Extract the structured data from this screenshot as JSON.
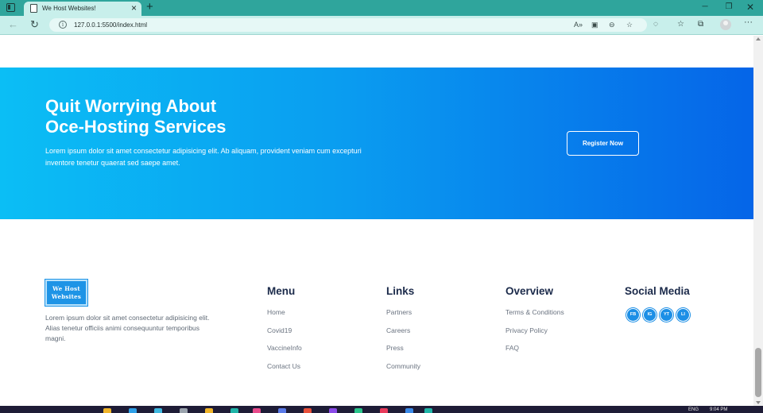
{
  "browser": {
    "tab_title": "We Host Websites!",
    "url": "127.0.0.1:5500/index.html",
    "new_tab": "+",
    "tab_close": "×"
  },
  "cta": {
    "title_line1": "Quit Worrying About",
    "title_line2": "Oce-Hosting Services",
    "description": "Lorem ipsum dolor sit amet consectetur adipisicing elit. Ab aliquam, provident veniam cum excepturi inventore tenetur quaerat sed saepe amet.",
    "button_label": "Register Now"
  },
  "footer": {
    "logo_line1": "We Host",
    "logo_line2": "Websites",
    "about": "Lorem ipsum dolor sit amet consectetur adipisicing elit. Alias tenetur officiis animi consequuntur temporibus magni.",
    "menu": {
      "heading": "Menu",
      "items": [
        "Home",
        "Covid19",
        "VaccineInfo",
        "Contact Us"
      ]
    },
    "links": {
      "heading": "Links",
      "items": [
        "Partners",
        "Careers",
        "Press",
        "Community"
      ]
    },
    "overview": {
      "heading": "Overview",
      "items": [
        "Terms & Conditions",
        "Privacy Policy",
        "FAQ"
      ]
    },
    "social": {
      "heading": "Social Media",
      "items": [
        "FB",
        "IG",
        "YT",
        "LI"
      ]
    }
  },
  "taskbar": {
    "language": "ENG",
    "time": "9:04 PM"
  },
  "colors": {
    "accent": "#0a9df0",
    "gradient_start": "#0bbef5",
    "gradient_end": "#0565e8",
    "heading": "#1b2a4a",
    "social": "#1c8fe6",
    "tab_bar": "#2fa59c"
  }
}
